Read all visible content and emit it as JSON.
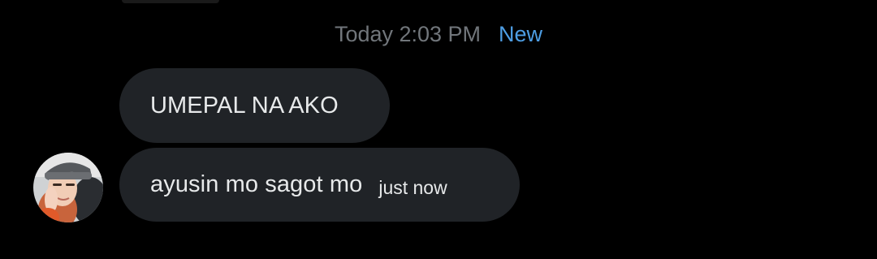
{
  "timestamp": {
    "time_label": "Today 2:03 PM",
    "new_label": "New"
  },
  "messages": [
    {
      "text": "UMEPAL NA AKO",
      "time": ""
    },
    {
      "text": "ayusin mo sagot mo",
      "time": "just now"
    }
  ],
  "avatar": {
    "icon": "avatar-photo"
  },
  "colors": {
    "background": "#000000",
    "bubble": "#202327",
    "muted_text": "#71767b",
    "accent": "#4e9ee4",
    "text": "#e7e9ea"
  }
}
